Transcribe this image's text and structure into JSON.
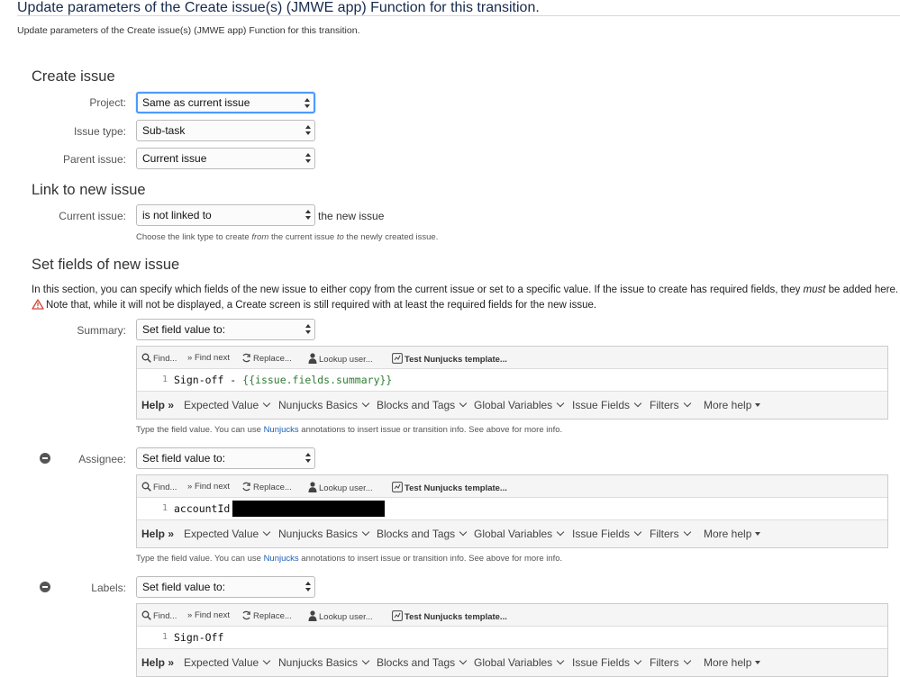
{
  "page": {
    "title": "Update parameters of the Create issue(s) (JMWE app) Function for this transition.",
    "description": "Update parameters of the Create issue(s) (JMWE app) Function for this transition."
  },
  "create_issue": {
    "heading": "Create issue",
    "project": {
      "label": "Project:",
      "value": "Same as current issue"
    },
    "issue_type": {
      "label": "Issue type:",
      "value": "Sub-task"
    },
    "parent_issue": {
      "label": "Parent issue:",
      "value": "Current issue"
    }
  },
  "link": {
    "heading": "Link to new issue",
    "current_issue_label": "Current issue:",
    "link_type_value": "is not linked to",
    "suffix": "the new issue",
    "hint_part1": "Choose the link type to create ",
    "hint_from": "from",
    "hint_part2": " the current issue ",
    "hint_to": "to",
    "hint_part3": " the newly created issue."
  },
  "set_fields": {
    "heading": "Set fields of new issue",
    "para1_part1": "In this section, you can specify which fields of the new issue to either copy from the current issue or set to a specific value. If the issue to create has required fields, they ",
    "para1_must": "must",
    "para1_part2": " be added here.",
    "para2": "Note that, while it will not be displayed, a Create screen is still required with at least the required fields for the new issue."
  },
  "toolbar": {
    "find": "Find...",
    "find_next": "Find next",
    "replace": "Replace...",
    "lookup_user": "Lookup user...",
    "test_template": "Test Nunjucks template..."
  },
  "helpbar": {
    "help": "Help",
    "expected_value": "Expected Value",
    "nunjucks_basics": "Nunjucks Basics",
    "blocks_and_tags": "Blocks and Tags",
    "global_variables": "Global Variables",
    "issue_fields": "Issue Fields",
    "filters": "Filters",
    "more_help": "More help"
  },
  "field_hint": {
    "part1": "Type the field value. You can use ",
    "link": "Nunjucks",
    "part2": " annotations to insert issue or transition info. See above for more info."
  },
  "fields": [
    {
      "label": "Summary:",
      "mode": "Set field value to:",
      "line_no": "1",
      "code_plain": "Sign-off - ",
      "code_template": "{{issue.fields.summary}}"
    },
    {
      "label": "Assignee:",
      "mode": "Set field value to:",
      "line_no": "1",
      "code_plain": "accountId:",
      "code_template": ""
    },
    {
      "label": "Labels:",
      "mode": "Set field value to:",
      "line_no": "1",
      "code_plain": "Sign-Off",
      "code_template": ""
    }
  ]
}
